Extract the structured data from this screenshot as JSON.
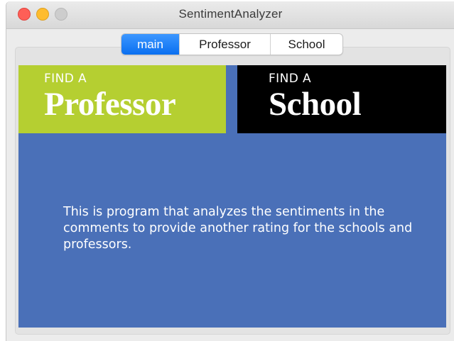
{
  "window": {
    "title": "SentimentAnalyzer"
  },
  "tabs": [
    {
      "label": "main",
      "active": true
    },
    {
      "label": "Professor",
      "active": false
    },
    {
      "label": "School",
      "active": false
    }
  ],
  "banners": {
    "professor": {
      "prefix": "FIND A",
      "label": "Professor",
      "color": "#b5cf31"
    },
    "school": {
      "prefix": "FIND A",
      "label": "School",
      "color": "#000000"
    }
  },
  "main": {
    "background": "#4a70b8",
    "description": "This is program that analyzes the sentiments in the comments to provide another rating for the schools and professors."
  },
  "colors": {
    "tab_active": "#0a6ff0",
    "close": "#fe5f57",
    "minimize": "#febc2e",
    "zoom_disabled": "#cdcdcd"
  }
}
